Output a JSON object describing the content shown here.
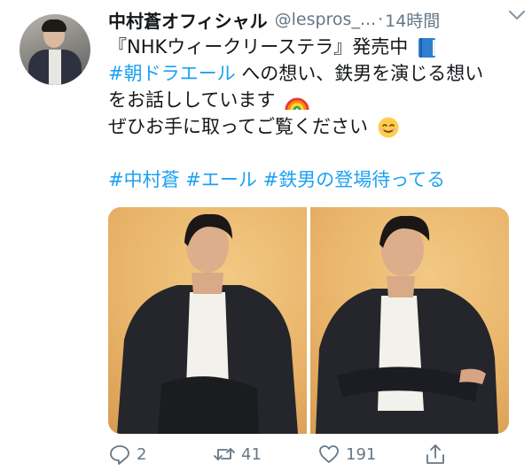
{
  "tweet": {
    "display_name": "中村蒼オフィシャル",
    "handle": "@lespros_...",
    "separator": "·",
    "time": "14時間",
    "lines": [
      "『NHKウィークリーステラ』発売中",
      "への想い、鉄男を演じる想い",
      "をお話ししています",
      "ぜひお手に取ってご覧ください"
    ],
    "hashtag_inline": "#朝ドラエール",
    "hashtags": [
      "#中村蒼",
      "#エール",
      "#鉄男の登場待ってる"
    ]
  },
  "actions": {
    "reply_count": "2",
    "retweet_count": "41",
    "like_count": "191"
  },
  "icons": {
    "caret": "chevron-down-icon",
    "reply": "reply-icon",
    "retweet": "retweet-icon",
    "like": "heart-icon",
    "share": "share-icon",
    "emoji_book": "blue-book-emoji",
    "emoji_rainbow": "rainbow-emoji",
    "emoji_smile": "smiling-face-emoji"
  },
  "colors": {
    "hashtag": "#1da1f2",
    "meta": "#657786",
    "text": "#14171a"
  }
}
